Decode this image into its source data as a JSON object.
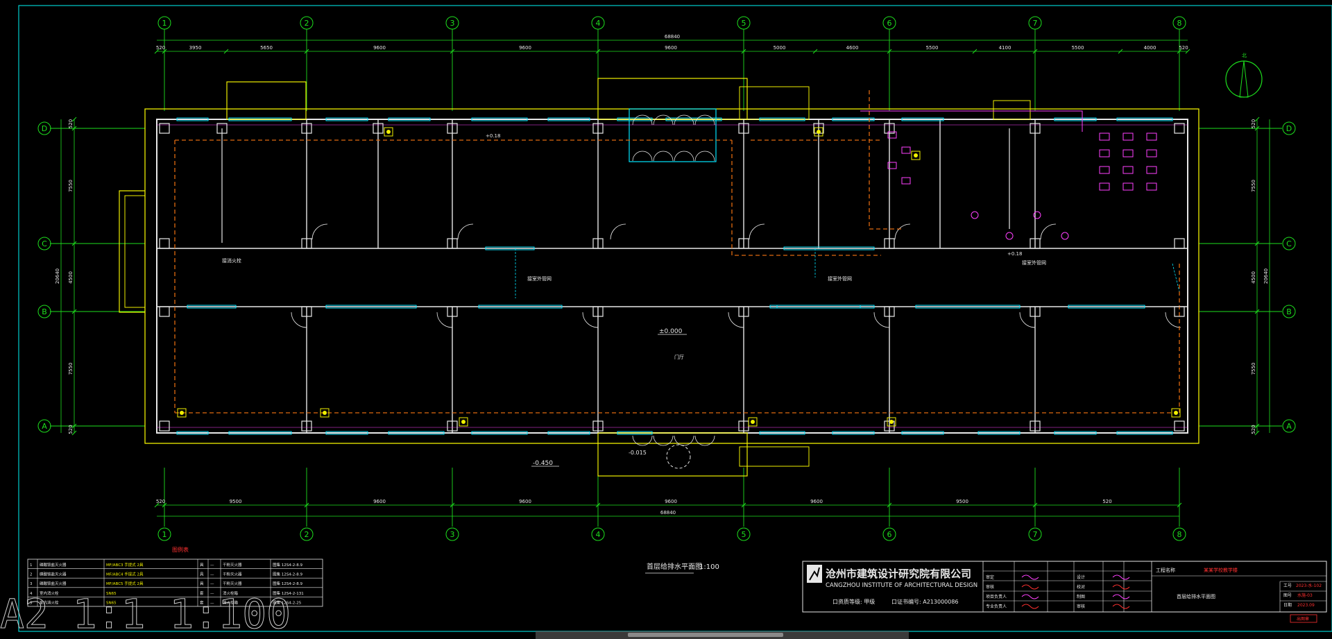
{
  "plan": {
    "grid_cols": [
      "1",
      "2",
      "3",
      "4",
      "5",
      "6",
      "7",
      "8"
    ],
    "grid_rows": [
      "D",
      "C",
      "B",
      "A"
    ],
    "top_dims": [
      "520",
      "3950",
      "5650",
      "9600",
      "9600",
      "9600",
      "5000",
      "4600",
      "5500",
      "4100",
      "5500",
      "4000",
      "520"
    ],
    "top_total": "68840",
    "bottom_dims": [
      "520",
      "9500",
      "9600",
      "9600",
      "9600",
      "9600",
      "9500",
      "520"
    ],
    "bottom_total": "68840",
    "left_dims": [
      "520",
      "7550",
      "4500",
      "7550",
      "520"
    ],
    "left_total": "20640",
    "right_dims": [
      "520",
      "7550",
      "4500",
      "7550",
      "520"
    ],
    "right_total": "20640",
    "elevations": {
      "floor": "±0.000",
      "outside_left": "-0.450",
      "outside_entry": "-0.015",
      "room_a": "+0.18",
      "room_b": "+0.18"
    },
    "hall_label": "门厅",
    "notes": [
      "接消火栓",
      "接室外管网",
      "接室外管网",
      "接室外管网"
    ],
    "plan_title": "首层给排水平面图",
    "plan_scale": "1:100",
    "north_label": "北"
  },
  "legend": {
    "heading": "图例表",
    "rows": [
      {
        "no": "1",
        "name": "磷酸铵盐灭火器",
        "spec": "MF/ABC3 手提式 2具",
        "unit": "具",
        "qty": "—",
        "remark": "干粉灭火器",
        "ref": "图集 12S4-2-8.9"
      },
      {
        "no": "2",
        "name": "磷酸铵盐灭火器",
        "spec": "MF/ABC4 手提式 2具",
        "unit": "具",
        "qty": "—",
        "remark": "干粉灭火器",
        "ref": "图集 12S4-2-8.9"
      },
      {
        "no": "3",
        "name": "磷酸铵盐灭火器",
        "spec": "MF/ABC5 手提式 2具",
        "unit": "具",
        "qty": "—",
        "remark": "干粉灭火器",
        "ref": "图集 12S4-2-8.9"
      },
      {
        "no": "4",
        "name": "室内消火栓",
        "spec": "SN65",
        "unit": "套",
        "qty": "—",
        "remark": "消火栓箱",
        "ref": "图集 12S4-2-131"
      },
      {
        "no": "5",
        "name": "室内消火栓",
        "spec": "SN65",
        "unit": "套",
        "qty": "—",
        "remark": "消火栓箱",
        "ref": "图集 12S4-2-25"
      }
    ]
  },
  "title_block": {
    "company_cn": "沧州市建筑设计研究院有限公司",
    "company_en": "CANGZHOU INSTITUTE OF ARCHITECTURAL DESIGN",
    "cert_1": "口资质等级: 甲级",
    "cert_2": "口证书编号: A213000086",
    "project_label": "工程名称",
    "project_name": "某某学校教学楼",
    "drawing_name": "首层给排水平面图",
    "drawing_no_label": "工号",
    "drawing_no": "2023-水-102",
    "sheet_label": "图号",
    "sheet": "水施-03",
    "date_label": "日期",
    "date": "2023.09",
    "roles": [
      "审定",
      "审核",
      "项目负责人",
      "专业负责人",
      "设计",
      "校对",
      "制图",
      "审核"
    ],
    "stamp": "出图章"
  },
  "watermark": "A2 1:1 1:100",
  "colors": {
    "grid": "#1ee01e",
    "wall": "#e8e8e8",
    "window": "#00e5ff",
    "pipe": "#e06a10",
    "pink": "#ff40ff",
    "yellow": "#f0f000",
    "frame": "#00cfcf"
  }
}
